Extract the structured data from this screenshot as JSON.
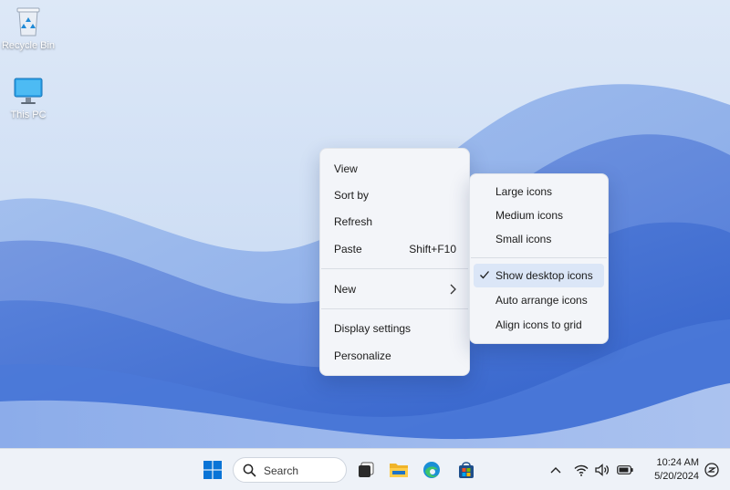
{
  "desktop": {
    "icons": [
      {
        "label": "Recycle Bin",
        "icon": "recycle-bin-icon"
      },
      {
        "label": "This PC",
        "icon": "computer-monitor-icon"
      }
    ]
  },
  "context_menu": {
    "items": [
      {
        "label": "View",
        "has_submenu": true
      },
      {
        "label": "Sort by"
      },
      {
        "label": "Refresh"
      },
      {
        "label": "Paste",
        "shortcut": "Shift+F10"
      },
      {
        "label": "New",
        "has_submenu": true
      },
      {
        "label": "Display settings"
      },
      {
        "label": "Personalize"
      }
    ]
  },
  "view_submenu": {
    "items": [
      {
        "label": "Large icons"
      },
      {
        "label": "Medium icons"
      },
      {
        "label": "Small icons"
      },
      {
        "label": "Show desktop icons",
        "checked": true
      },
      {
        "label": "Auto arrange icons"
      },
      {
        "label": "Align icons to grid"
      }
    ]
  },
  "taskbar": {
    "search_label": "Search",
    "apps": [
      "start-icon",
      "task-view-icon",
      "file-explorer-icon",
      "edge-icon",
      "store-icon"
    ],
    "tray_icons": [
      "chevron-up-icon",
      "wifi-icon",
      "volume-icon",
      "battery-icon",
      "notification-icon"
    ],
    "time": "10:24 AM",
    "date": "5/20/2024"
  },
  "colors": {
    "accent": "#0067c0",
    "wallpaper_light": "#cfdff5",
    "wallpaper_blue": "#3d6fd4",
    "menu_bg": "#f3f5f9",
    "highlight": "#dbe6f7"
  }
}
